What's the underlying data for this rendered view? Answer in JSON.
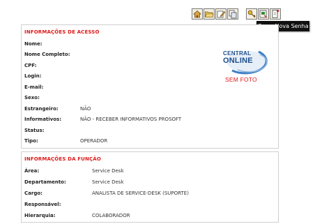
{
  "toolbar": {
    "buttons": [
      {
        "icon": "home-icon"
      },
      {
        "icon": "folder-open-icon"
      },
      {
        "icon": "edit-icon"
      },
      {
        "icon": "copy-icon"
      },
      {
        "icon": "key-icon"
      },
      {
        "icon": "refresh-password-icon"
      },
      {
        "icon": "document-edit-icon"
      }
    ],
    "tooltip": "Gerar Nova Senha"
  },
  "access_info": {
    "title": "INFORMAÇÕES DE ACESSO",
    "fields": [
      {
        "label": "Nome:",
        "value": ""
      },
      {
        "label": "Nome Completo:",
        "value": ""
      },
      {
        "label": "CPF:",
        "value": ""
      },
      {
        "label": "Login:",
        "value": ""
      },
      {
        "label": "E-mail:",
        "value": ""
      },
      {
        "label": "Sexo:",
        "value": ""
      },
      {
        "label": "Estrangeiro:",
        "value": "NÃO"
      },
      {
        "label": "Informativos:",
        "value": "NÃO - RECEBER INFORMATIVOS PROSOFT"
      },
      {
        "label": "Status:",
        "value": ""
      },
      {
        "label": "Tipo:",
        "value": "OPERADOR"
      }
    ],
    "logo": {
      "line1": "CENTRAL",
      "line2": "ONLINE"
    },
    "photo_placeholder": "SEM FOTO"
  },
  "function_info": {
    "title": "INFORMAÇÕES DA FUNÇÃO",
    "fields": [
      {
        "label": "Área:",
        "value": "Service Desk"
      },
      {
        "label": "Departamento:",
        "value": "Service Desk"
      },
      {
        "label": "Cargo:",
        "value": "ANALISTA DE SERVICE-DESK (SUPORTE)"
      },
      {
        "label": "Responsável:",
        "value": ""
      },
      {
        "label": "Hierarquia:",
        "value": "COLABORADOR"
      }
    ]
  },
  "colors": {
    "accent_red": "#e01919",
    "logo_blue": "#1c4e8c",
    "border": "#cfcfcf"
  }
}
